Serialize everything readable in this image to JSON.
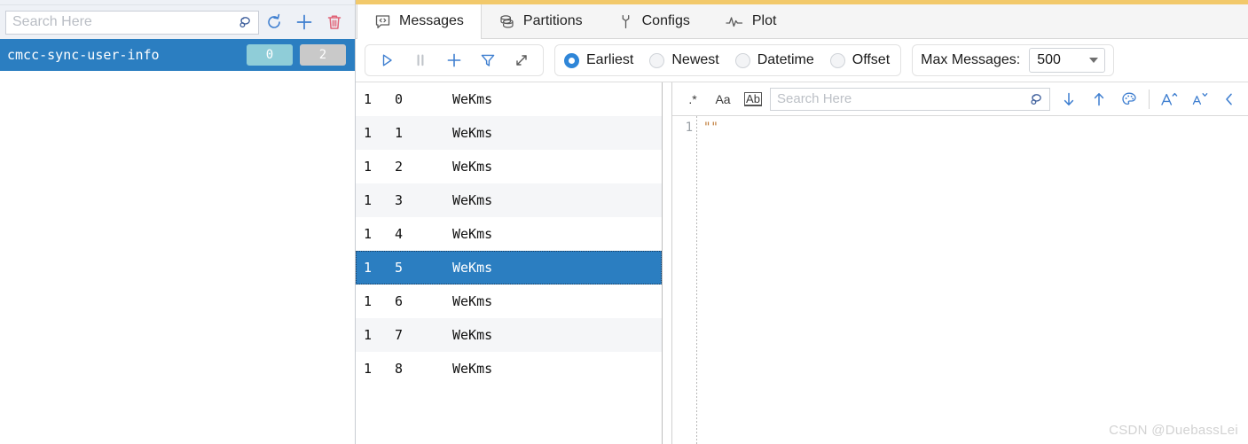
{
  "left_panel": {
    "search": {
      "placeholder": "Search Here",
      "value": "",
      "icon": "search-icon"
    },
    "toolbar": [
      {
        "name": "refresh-button",
        "icon": "refresh-icon"
      },
      {
        "name": "add-topic-button",
        "icon": "plus-icon"
      },
      {
        "name": "delete-topic-button",
        "icon": "trash-icon"
      }
    ],
    "topics": [
      {
        "name": "cmcc-sync-user-info",
        "badges": [
          {
            "label": "0",
            "color": "#8fcdd8"
          },
          {
            "label": "2",
            "color": "#c9c9c9"
          }
        ],
        "selected": true
      }
    ]
  },
  "tabs": [
    {
      "label": "Messages",
      "icon": "message-code-icon",
      "active": true
    },
    {
      "label": "Partitions",
      "icon": "database-icon",
      "active": false
    },
    {
      "label": "Configs",
      "icon": "wrench-icon",
      "active": false
    },
    {
      "label": "Plot",
      "icon": "pulse-icon",
      "active": false
    }
  ],
  "controlbar": {
    "actions": [
      {
        "name": "play-button",
        "icon": "play-icon",
        "enabled": true
      },
      {
        "name": "pause-button",
        "icon": "pause-icon",
        "enabled": false
      },
      {
        "name": "add-button",
        "icon": "plus-icon",
        "enabled": true
      },
      {
        "name": "filter-button",
        "icon": "funnel-icon",
        "enabled": true
      },
      {
        "name": "expand-button",
        "icon": "expand-diagonal-icon",
        "enabled": true
      }
    ],
    "offset_modes": [
      {
        "label": "Earliest",
        "selected": true
      },
      {
        "label": "Newest",
        "selected": false
      },
      {
        "label": "Datetime",
        "selected": false
      },
      {
        "label": "Offset",
        "selected": false
      }
    ],
    "max_messages": {
      "label": "Max Messages:",
      "value": "500"
    }
  },
  "message_table": {
    "rows": [
      {
        "partition": "1",
        "offset": "0",
        "key": "WeKms",
        "selected": false
      },
      {
        "partition": "1",
        "offset": "1",
        "key": "WeKms",
        "selected": false
      },
      {
        "partition": "1",
        "offset": "2",
        "key": "WeKms",
        "selected": false
      },
      {
        "partition": "1",
        "offset": "3",
        "key": "WeKms",
        "selected": false
      },
      {
        "partition": "1",
        "offset": "4",
        "key": "WeKms",
        "selected": false
      },
      {
        "partition": "1",
        "offset": "5",
        "key": "WeKms",
        "selected": true
      },
      {
        "partition": "1",
        "offset": "6",
        "key": "WeKms",
        "selected": false
      },
      {
        "partition": "1",
        "offset": "7",
        "key": "WeKms",
        "selected": false
      },
      {
        "partition": "1",
        "offset": "8",
        "key": "WeKms",
        "selected": false
      }
    ]
  },
  "content_pane": {
    "findbar": {
      "regex_label": ".*",
      "case_label": "Aa",
      "word_label": "Ab",
      "search": {
        "placeholder": "Search Here",
        "value": "",
        "icon": "search-icon"
      },
      "buttons": [
        {
          "name": "find-next-button",
          "icon": "arrow-down-icon"
        },
        {
          "name": "find-previous-button",
          "icon": "arrow-up-icon"
        },
        {
          "name": "highlight-color-button",
          "icon": "palette-icon"
        },
        {
          "name": "increase-font-button",
          "icon": "font-increase-icon"
        },
        {
          "name": "decrease-font-button",
          "icon": "font-decrease-icon"
        },
        {
          "name": "collapse-panel-button",
          "icon": "chevron-left-icon"
        }
      ]
    },
    "editor": {
      "line_numbers": [
        "1"
      ],
      "lines": [
        "\"\""
      ],
      "text_color": "#c07c3a"
    }
  },
  "watermark": "CSDN @DuebassLei"
}
